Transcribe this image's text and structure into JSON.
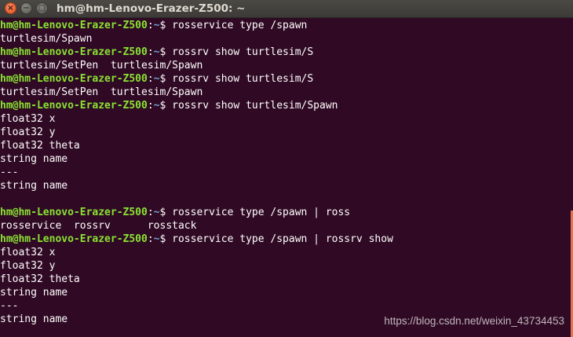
{
  "window": {
    "title": "hm@hm-Lenovo-Erazer-Z500: ~",
    "close_glyph": "×",
    "minimize_glyph": "−",
    "maximize_glyph": "□"
  },
  "colors": {
    "background": "#300a24",
    "user_host": "#8ae234",
    "path": "#729fcf",
    "text": "#ffffff",
    "scrollbar": "#e8724a"
  },
  "terminal": {
    "lines": [
      {
        "type": "prompt",
        "user": "hm@hm-Lenovo-Erazer-Z500",
        "sep": ":",
        "path": "~",
        "symbol": "$ ",
        "command": "rosservice type /spawn"
      },
      {
        "type": "output",
        "text": "turtlesim/Spawn"
      },
      {
        "type": "prompt",
        "user": "hm@hm-Lenovo-Erazer-Z500",
        "sep": ":",
        "path": "~",
        "symbol": "$ ",
        "command": "rossrv show turtlesim/S"
      },
      {
        "type": "output",
        "text": "turtlesim/SetPen  turtlesim/Spawn"
      },
      {
        "type": "prompt",
        "user": "hm@hm-Lenovo-Erazer-Z500",
        "sep": ":",
        "path": "~",
        "symbol": "$ ",
        "command": "rossrv show turtlesim/S"
      },
      {
        "type": "output",
        "text": "turtlesim/SetPen  turtlesim/Spawn"
      },
      {
        "type": "prompt",
        "user": "hm@hm-Lenovo-Erazer-Z500",
        "sep": ":",
        "path": "~",
        "symbol": "$ ",
        "command": "rossrv show turtlesim/Spawn"
      },
      {
        "type": "output",
        "text": "float32 x"
      },
      {
        "type": "output",
        "text": "float32 y"
      },
      {
        "type": "output",
        "text": "float32 theta"
      },
      {
        "type": "output",
        "text": "string name"
      },
      {
        "type": "output",
        "text": "---"
      },
      {
        "type": "output",
        "text": "string name"
      },
      {
        "type": "output",
        "text": ""
      },
      {
        "type": "prompt",
        "user": "hm@hm-Lenovo-Erazer-Z500",
        "sep": ":",
        "path": "~",
        "symbol": "$ ",
        "command": "rosservice type /spawn | ross"
      },
      {
        "type": "output",
        "text": "rosservice  rossrv      rosstack"
      },
      {
        "type": "prompt",
        "user": "hm@hm-Lenovo-Erazer-Z500",
        "sep": ":",
        "path": "~",
        "symbol": "$ ",
        "command": "rosservice type /spawn | rossrv show"
      },
      {
        "type": "output",
        "text": "float32 x"
      },
      {
        "type": "output",
        "text": "float32 y"
      },
      {
        "type": "output",
        "text": "float32 theta"
      },
      {
        "type": "output",
        "text": "string name"
      },
      {
        "type": "output",
        "text": "---"
      },
      {
        "type": "output",
        "text": "string name"
      }
    ]
  },
  "watermark": "https://blog.csdn.net/weixin_43734453"
}
